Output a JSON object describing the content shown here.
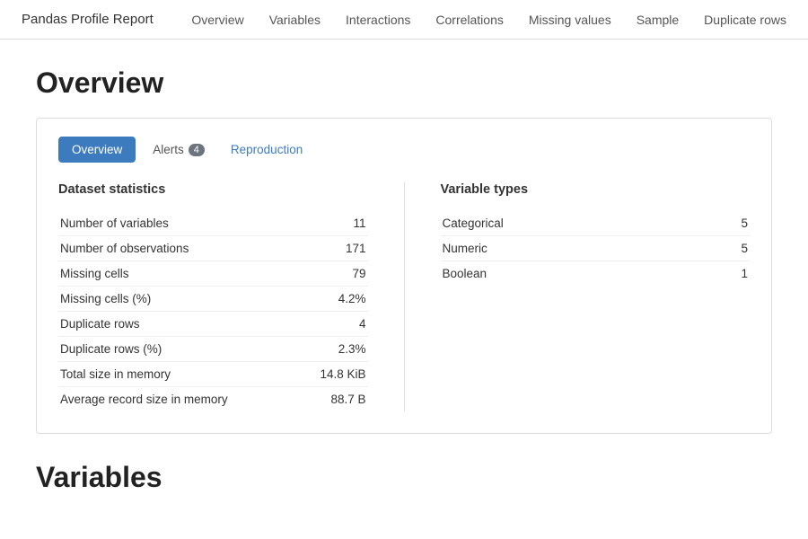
{
  "brand": "Pandas Profile Report",
  "nav": {
    "items": [
      {
        "label": "Overview"
      },
      {
        "label": "Variables"
      },
      {
        "label": "Interactions"
      },
      {
        "label": "Correlations"
      },
      {
        "label": "Missing values"
      },
      {
        "label": "Sample"
      },
      {
        "label": "Duplicate rows"
      }
    ]
  },
  "overview_section": {
    "title": "Overview",
    "tabs": [
      {
        "label": "Overview",
        "active": true,
        "badge": null
      },
      {
        "label": "Alerts",
        "active": false,
        "badge": "4"
      },
      {
        "label": "Reproduction",
        "active": false,
        "badge": null,
        "link": true
      }
    ],
    "dataset_statistics": {
      "title": "Dataset statistics",
      "rows": [
        {
          "label": "Number of variables",
          "value": "11"
        },
        {
          "label": "Number of observations",
          "value": "171"
        },
        {
          "label": "Missing cells",
          "value": "79"
        },
        {
          "label": "Missing cells (%)",
          "value": "4.2%"
        },
        {
          "label": "Duplicate rows",
          "value": "4"
        },
        {
          "label": "Duplicate rows (%)",
          "value": "2.3%"
        },
        {
          "label": "Total size in memory",
          "value": "14.8 KiB"
        },
        {
          "label": "Average record size in memory",
          "value": "88.7 B"
        }
      ]
    },
    "variable_types": {
      "title": "Variable types",
      "rows": [
        {
          "label": "Categorical",
          "value": "5"
        },
        {
          "label": "Numeric",
          "value": "5"
        },
        {
          "label": "Boolean",
          "value": "1"
        }
      ]
    }
  },
  "variables_section": {
    "title": "Variables"
  }
}
